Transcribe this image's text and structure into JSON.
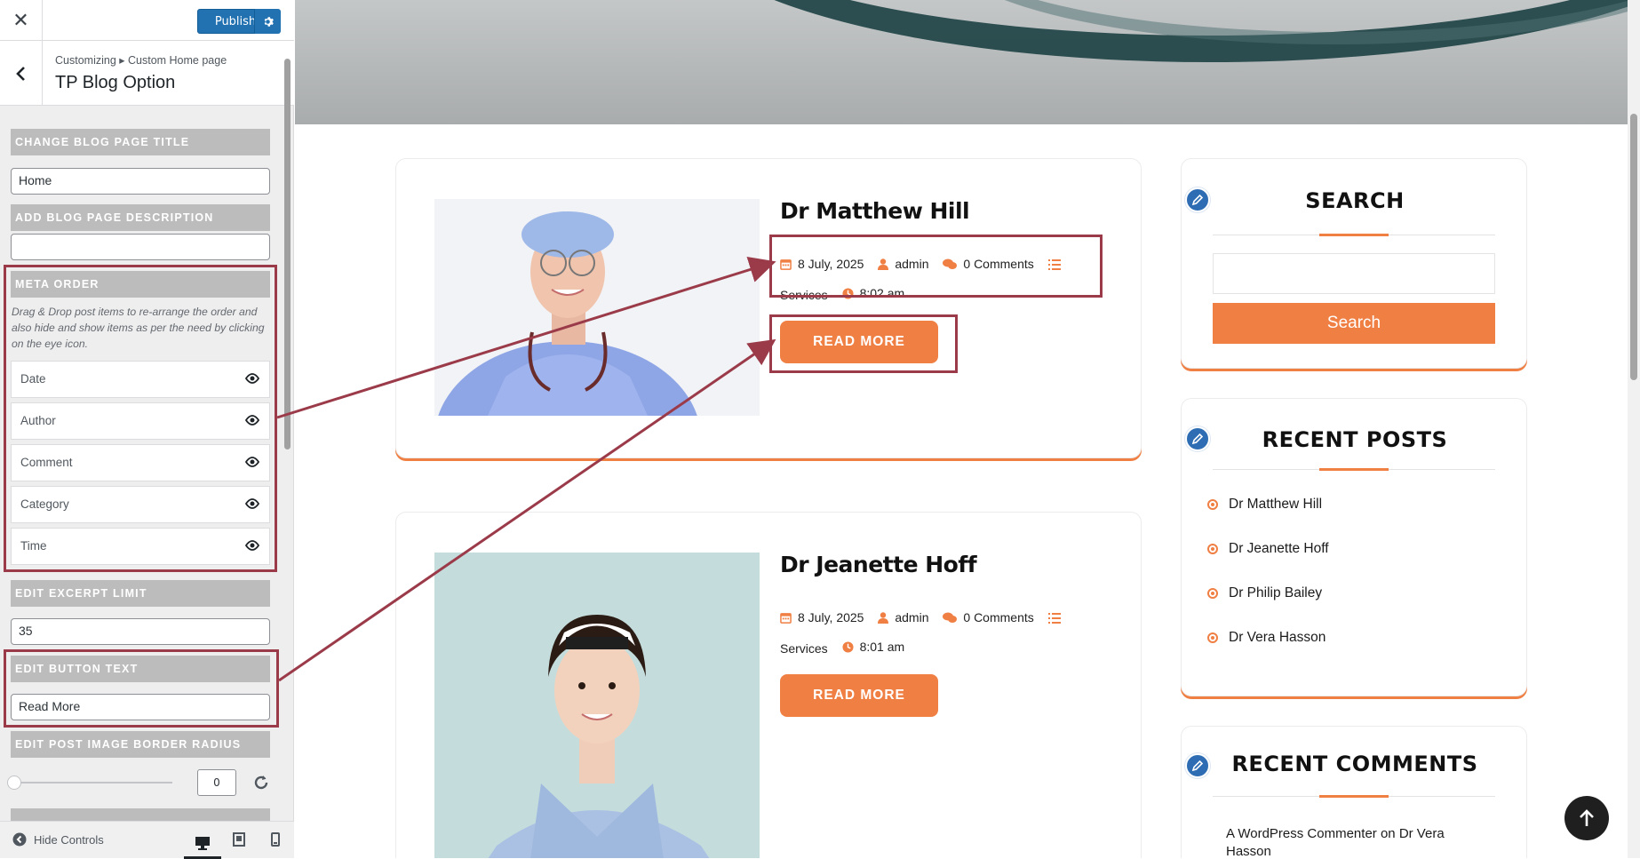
{
  "topbar": {
    "close_symbol": "✕",
    "publish_label": "Publish"
  },
  "section": {
    "breadcrumb": "Customizing ▸ Custom Home page",
    "title": "TP Blog Option"
  },
  "controls": {
    "blog_title_label": "CHANGE BLOG PAGE TITLE",
    "blog_title_value": "Home",
    "blog_desc_label": "ADD BLOG PAGE DESCRIPTION",
    "blog_desc_value": "",
    "meta_order_label": "META ORDER",
    "meta_order_desc": "Drag & Drop post items to re-arrange the order and also hide and show items as per the need by clicking on the eye icon.",
    "meta_items": [
      "Date",
      "Author",
      "Comment",
      "Category",
      "Time"
    ],
    "excerpt_label": "EDIT EXCERPT LIMIT",
    "excerpt_value": "35",
    "button_text_label": "EDIT BUTTON TEXT",
    "button_text_value": "Read More",
    "radius_label": "EDIT POST IMAGE BORDER RADIUS",
    "radius_value": "0",
    "radius_slider_fraction": 0
  },
  "footer": {
    "hide_controls_label": "Hide Controls"
  },
  "posts": [
    {
      "title": "Dr Matthew Hill",
      "date": "8 July, 2025",
      "author": "admin",
      "comments": "0 Comments",
      "category": "Services",
      "time": "8:02 am",
      "button": "READ MORE"
    },
    {
      "title": "Dr Jeanette Hoff",
      "date": "8 July, 2025",
      "author": "admin",
      "comments": "0 Comments",
      "category": "Services",
      "time": "8:01 am",
      "button": "READ MORE"
    }
  ],
  "sidebar": {
    "search_title": "SEARCH",
    "search_placeholder": "",
    "search_button": "Search",
    "recent_posts_title": "RECENT POSTS",
    "recent_posts": [
      "Dr Matthew Hill",
      "Dr Jeanette Hoff",
      "Dr Philip Bailey",
      "Dr Vera Hasson"
    ],
    "recent_comments_title": "RECENT COMMENTS",
    "recent_comment_author": "A WordPress Commenter",
    "recent_comment_on": "on",
    "recent_comment_post": "Dr Vera Hasson"
  },
  "colors": {
    "accent": "#f07f43",
    "wp_blue": "#2271b1",
    "highlight": "#9b3b4a",
    "widget_icon": "#2e6db3"
  },
  "icons": [
    "close-icon",
    "gear-icon",
    "chevron-left-icon",
    "eye-icon",
    "reset-icon",
    "desktop-icon",
    "tablet-icon",
    "mobile-icon",
    "calendar-icon",
    "user-icon",
    "comments-icon",
    "list-icon",
    "clock-icon",
    "pencil-icon",
    "arrow-up-icon"
  ]
}
